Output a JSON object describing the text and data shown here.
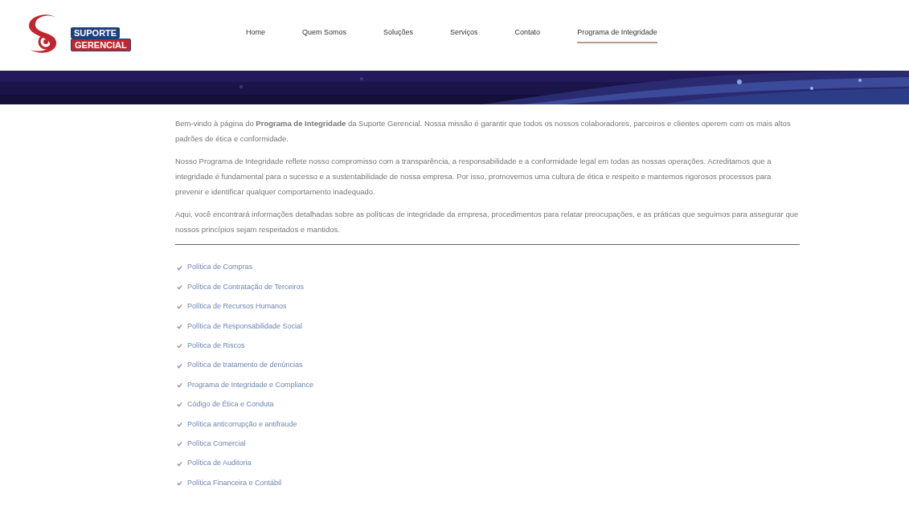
{
  "logo": {
    "line_1": "SUPORTE",
    "line_2": "GERENCIAL"
  },
  "nav": [
    {
      "label": "Home",
      "selected": false
    },
    {
      "label": "Quem Somos",
      "selected": false
    },
    {
      "label": "Soluções",
      "selected": false
    },
    {
      "label": "Serviços",
      "selected": false
    },
    {
      "label": "Contato",
      "selected": false
    },
    {
      "label": "Programa de Integridade",
      "selected": true
    }
  ],
  "paragraphs": [
    "Bem-vindo à página do **Programa de Integridade** da Suporte Gerencial. Nossa missão é garantir que todos os nossos colaboradores, parceiros e clientes operem com os mais altos padrões de ética e conformidade.",
    "Nosso Programa de Integridade reflete nosso compromisso com a transparência, a responsabilidade e a conformidade legal em todas as nossas operações. Acreditamos que a integridade é fundamental para o sucesso e a sustentabilidade de nossa empresa. Por isso, promovemos uma cultura de ética e respeito e mantemos rigorosos processos para prevenir e identificar qualquer comportamento inadequado.",
    "Aqui, você encontrará informações detalhadas sobre as políticas de integridade da empresa, procedimentos para relatar preocupações, e as práticas que seguimos para assegurar que nossos princípios sejam respeitados e mantidos."
  ],
  "policies": [
    "Política de Compras",
    "Política de Contratação de Terceiros",
    "Política de Recursos Humanos",
    "Política de Responsabilidade Social",
    "Política de Riscos",
    "Política de tratamento de denúncias",
    "Programa de Integridade e Compliance",
    "Código de Ética e Conduta",
    "Política anticorrupção e antifraude",
    "Política Comercial",
    "Política de Auditoria",
    "Política Financeira e Contábil"
  ]
}
